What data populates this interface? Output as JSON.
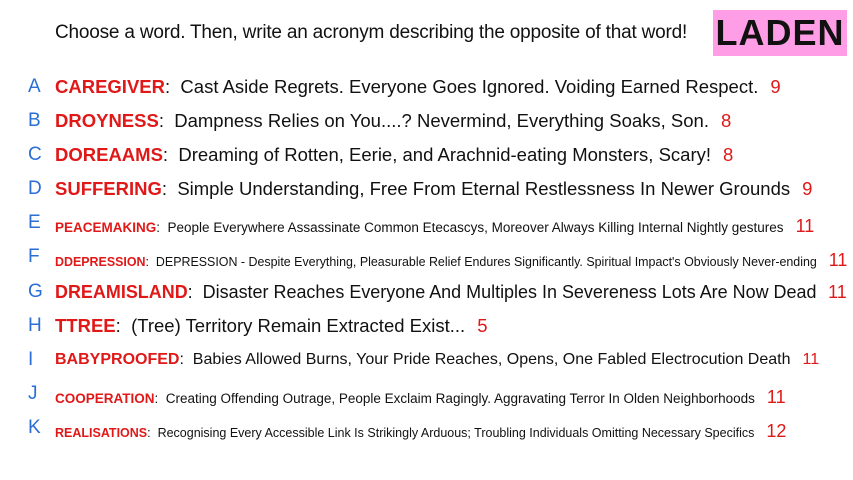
{
  "prompt": "Choose a word. Then, write an acronym describing the opposite of that word!",
  "badge": "LADEN",
  "colors": {
    "badge_bg": "#ff9ee6",
    "word": "#e01818",
    "letter": "#2a6fd6",
    "count": "#e01818"
  },
  "rows": [
    {
      "letter": "A",
      "word": "CAREGIVER",
      "acronym": "Cast Aside Regrets. Everyone Goes Ignored. Voiding Earned Respect.",
      "count": "9"
    },
    {
      "letter": "B",
      "word": "DROYNESS",
      "acronym": "Dampness Relies on You....? Nevermind, Everything Soaks, Son.",
      "count": "8"
    },
    {
      "letter": "C",
      "word": "DOREAAMS",
      "acronym": "Dreaming of  Rotten, Eerie, and Arachnid-eating Monsters, Scary!",
      "count": "8"
    },
    {
      "letter": "D",
      "word": "SUFFERING",
      "acronym": "Simple Understanding, Free From Eternal Restlessness In Newer Grounds",
      "count": "9"
    },
    {
      "letter": "E",
      "word": "PEACEMAKING",
      "acronym": "People Everywhere Assassinate Common Etecascys, Moreover Always Killing Internal Nightly gestures",
      "count": "11"
    },
    {
      "letter": "F",
      "word": "DDEPRESSION",
      "acronym": "DEPRESSION - Despite Everything, Pleasurable Relief Endures Significantly. Spiritual Impact's Obviously Never-ending",
      "count": "11"
    },
    {
      "letter": "G",
      "word": "DREAMISLAND",
      "acronym": "Disaster Reaches Everyone And Multiples In Severeness Lots Are Now Dead",
      "count": "11"
    },
    {
      "letter": "H",
      "word": "TTREE",
      "acronym": "(Tree) Territory Remain Extracted Exist...",
      "count": "5"
    },
    {
      "letter": "I",
      "word": "BABYPROOFED",
      "acronym": "Babies Allowed Burns, Your Pride Reaches, Opens, One Fabled Electrocution Death",
      "count": "11"
    },
    {
      "letter": "J",
      "word": "COOPERATION",
      "acronym": "Creating Offending Outrage, People Exclaim Ragingly. Aggravating Terror In Olden Neighborhoods",
      "count": "11"
    },
    {
      "letter": "K",
      "word": "REALISATIONS",
      "acronym": "Recognising Every Accessible Link Is Strikingly Arduous; Troubling Individuals Omitting Necessary Specifics",
      "count": "12"
    }
  ]
}
